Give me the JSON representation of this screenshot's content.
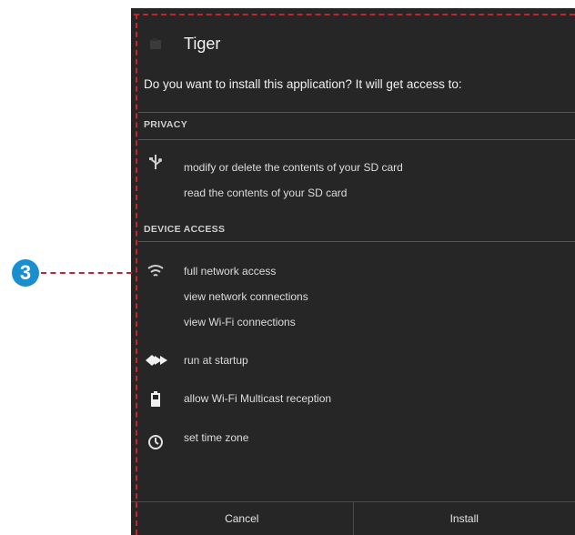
{
  "app": {
    "title": "Tiger",
    "icon": "android-app-icon"
  },
  "prompt": "Do you want to install this application? It will get access to:",
  "sections": {
    "privacy": {
      "header": "PRIVACY",
      "icon": "usb-icon",
      "items": [
        "modify or delete the contents of your SD card",
        "read the contents of your SD card"
      ]
    },
    "device_access": {
      "header": "DEVICE ACCESS",
      "network": {
        "icon": "wifi-icon",
        "items": [
          "full network access",
          "view network connections",
          "view Wi-Fi connections"
        ]
      },
      "startup": {
        "icon": "startup-icon",
        "label": "run at startup"
      },
      "multicast": {
        "icon": "battery-icon",
        "label": "allow Wi-Fi Multicast reception"
      },
      "timezone": {
        "icon": "clock-icon",
        "label": "set time zone"
      }
    }
  },
  "buttons": {
    "cancel": "Cancel",
    "install": "Install"
  },
  "annotation": {
    "number": "3"
  },
  "colors": {
    "dialog_bg": "#262626",
    "annotation_blue": "#1a8fd0",
    "annotation_red": "#c8232b"
  }
}
